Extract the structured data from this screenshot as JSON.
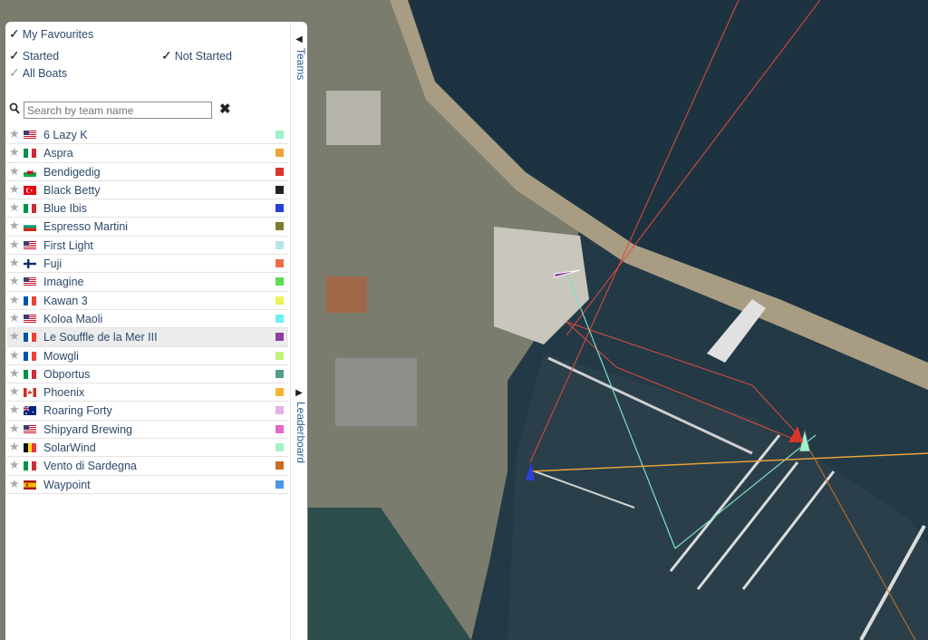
{
  "filters": {
    "favourites": "My Favourites",
    "started": "Started",
    "not_started": "Not Started",
    "all_boats": "All Boats"
  },
  "search": {
    "placeholder": "Search by team name"
  },
  "tabs": {
    "teams": "Teams",
    "leaderboard": "Leaderboard"
  },
  "teams": [
    {
      "name": "6 Lazy K",
      "flag": "us",
      "color": "#9ef0c8"
    },
    {
      "name": "Aspra",
      "flag": "it",
      "color": "#f2a33a"
    },
    {
      "name": "Bendigedig",
      "flag": "wales",
      "color": "#d9362b"
    },
    {
      "name": "Black Betty",
      "flag": "tr",
      "color": "#222222"
    },
    {
      "name": "Blue Ibis",
      "flag": "it",
      "color": "#2b3fd9"
    },
    {
      "name": "Espresso Martini",
      "flag": "bg",
      "color": "#7d7a2d"
    },
    {
      "name": "First Light",
      "flag": "us",
      "color": "#b7e4ea"
    },
    {
      "name": "Fuji",
      "flag": "fi",
      "color": "#ee6b47"
    },
    {
      "name": "Imagine",
      "flag": "us",
      "color": "#5fdb52"
    },
    {
      "name": "Kawan 3",
      "flag": "fr",
      "color": "#eef05a"
    },
    {
      "name": "Koloa Maoli",
      "flag": "us",
      "color": "#6ef0f0"
    },
    {
      "name": "Le Souffle de la Mer III",
      "flag": "fr",
      "color": "#8a3fa6"
    },
    {
      "name": "Mowgli",
      "flag": "fr",
      "color": "#c4f07a"
    },
    {
      "name": "Obportus",
      "flag": "it",
      "color": "#4e9e8a"
    },
    {
      "name": "Phoenix",
      "flag": "ca",
      "color": "#f4b433"
    },
    {
      "name": "Roaring Forty",
      "flag": "au",
      "color": "#e6b0e0"
    },
    {
      "name": "Shipyard Brewing",
      "flag": "us",
      "color": "#e36ac5"
    },
    {
      "name": "SolarWind",
      "flag": "be",
      "color": "#a6f2c8"
    },
    {
      "name": "Vento di Sardegna",
      "flag": "it",
      "color": "#cc6b24"
    },
    {
      "name": "Waypoint",
      "flag": "es",
      "color": "#4b97e8"
    }
  ],
  "selected_team": "Le Souffle de la Mer III"
}
